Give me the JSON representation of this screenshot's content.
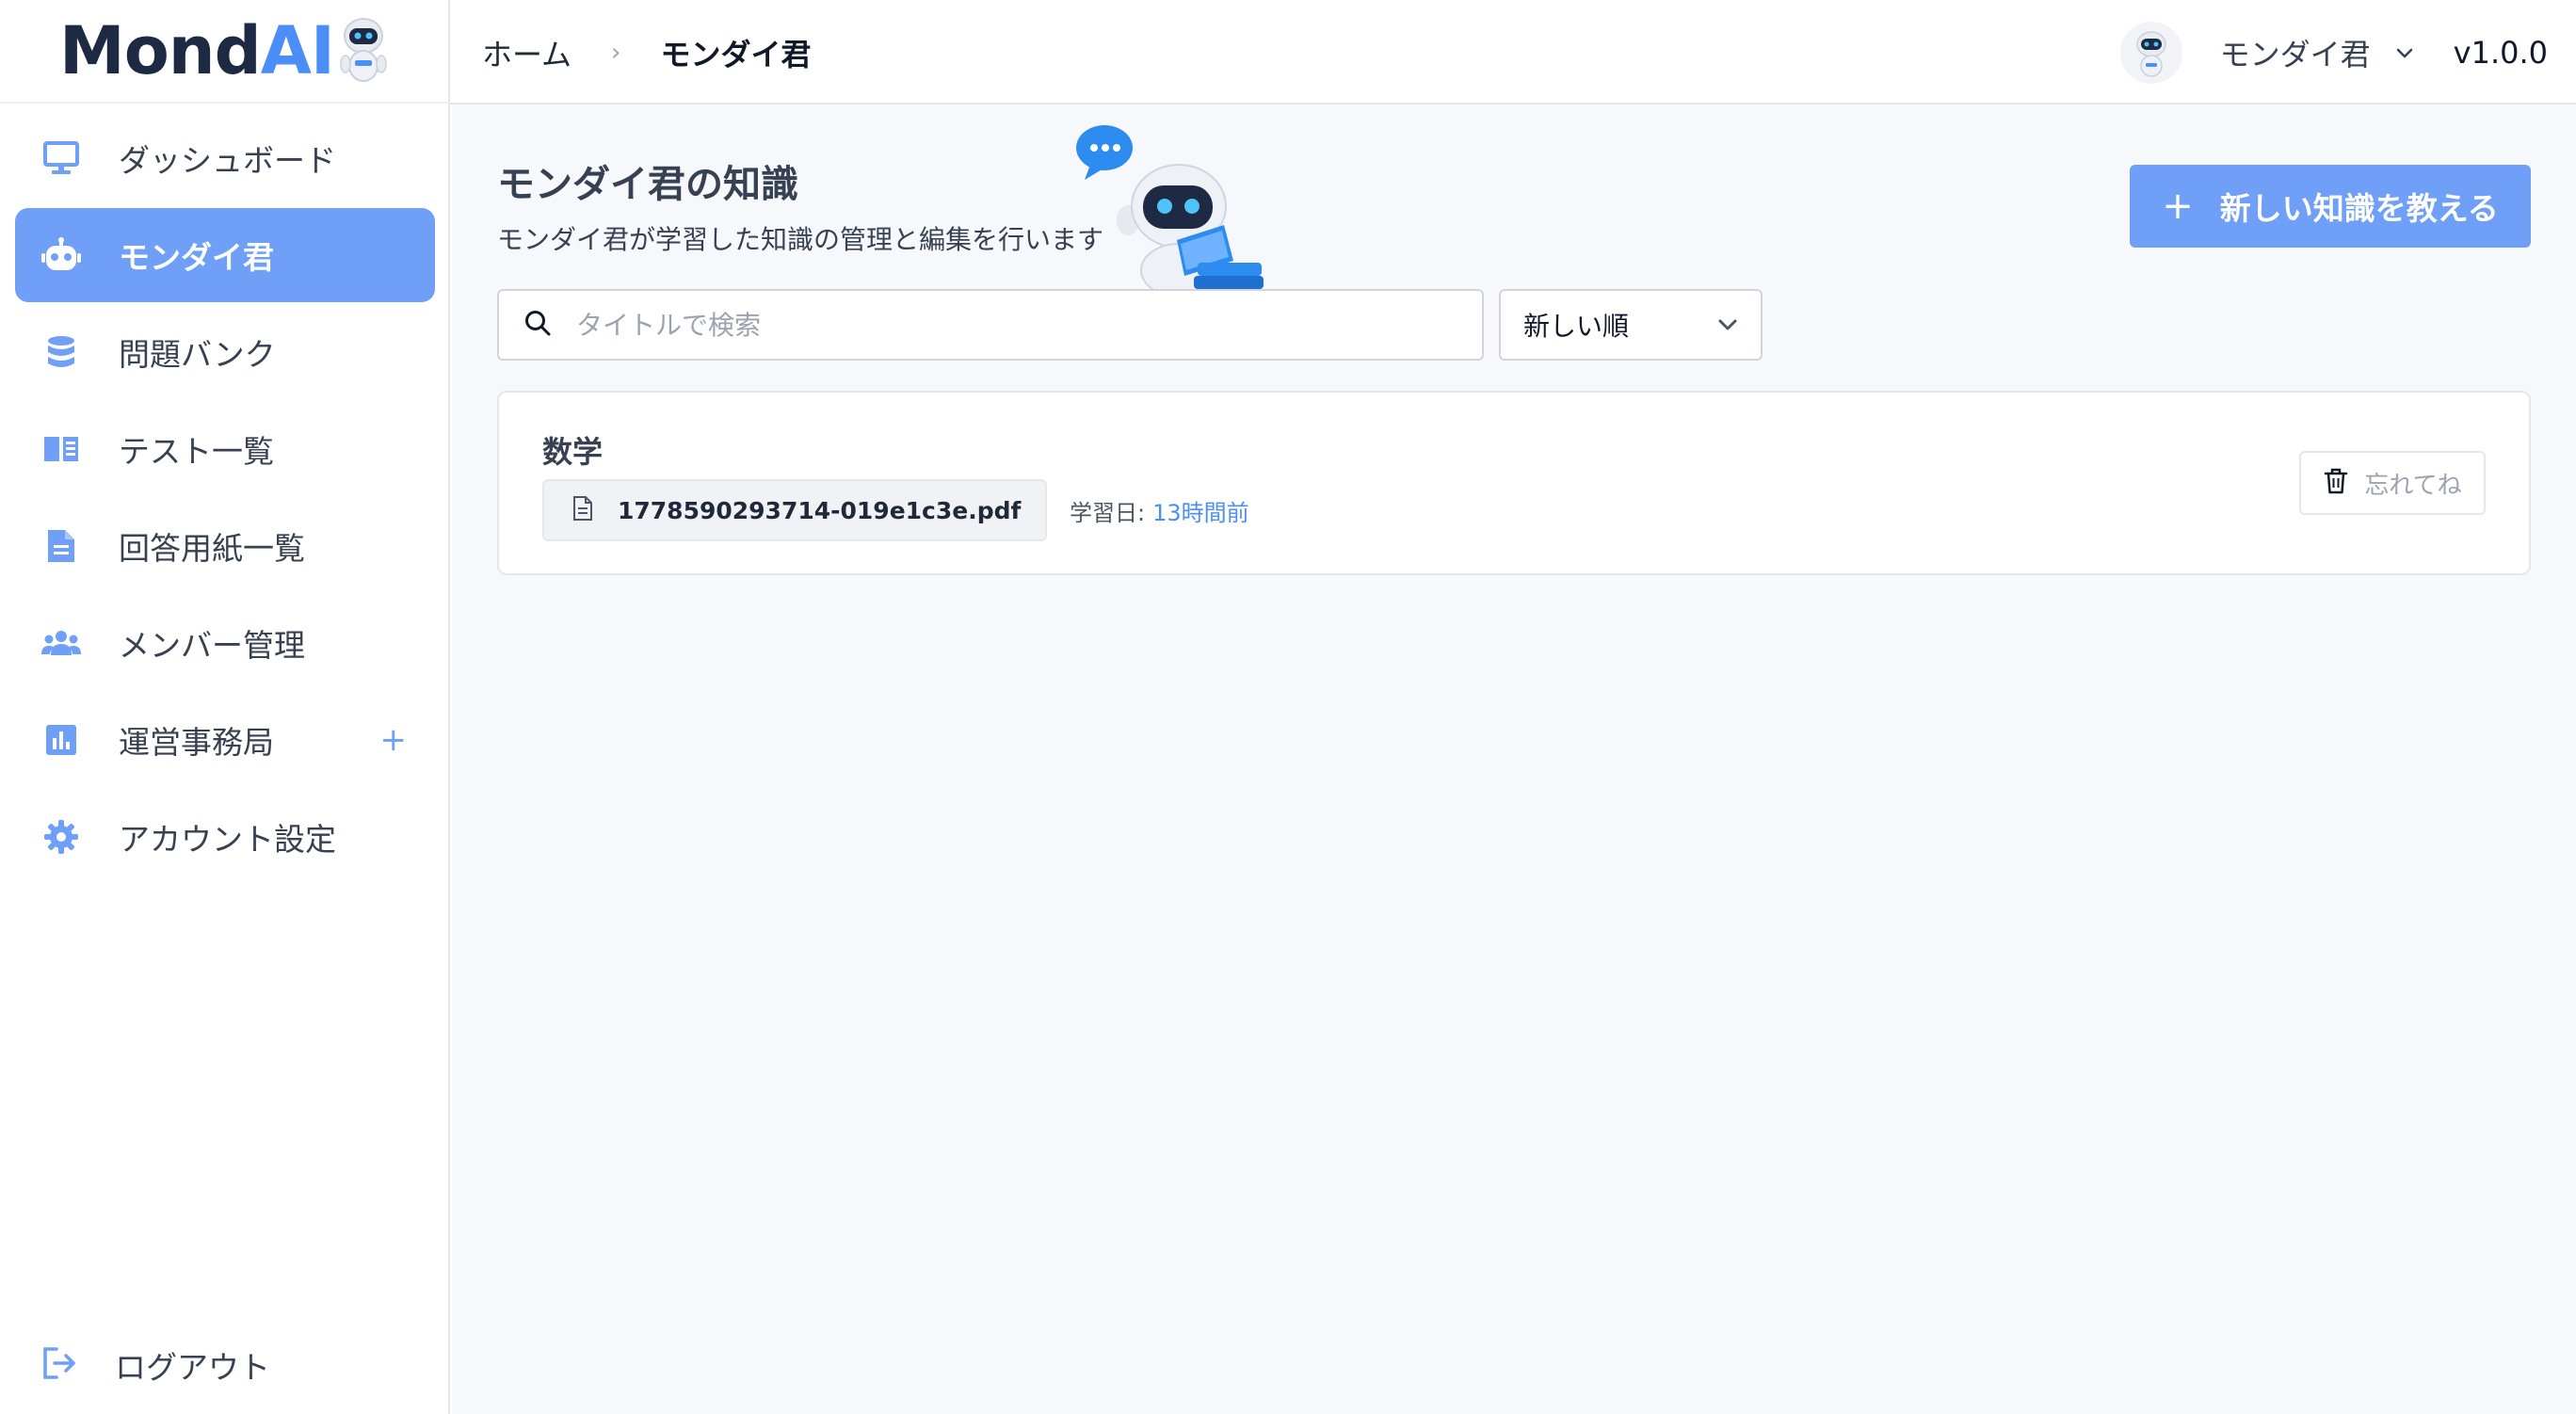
{
  "brand": {
    "logo_main": "Mond",
    "logo_accent": "AI"
  },
  "sidebar": {
    "items": [
      {
        "label": "ダッシュボード",
        "icon": "monitor-icon"
      },
      {
        "label": "モンダイ君",
        "icon": "robot-icon",
        "active": true
      },
      {
        "label": "問題バンク",
        "icon": "database-icon"
      },
      {
        "label": "テスト一覧",
        "icon": "book-open-icon"
      },
      {
        "label": "回答用紙一覧",
        "icon": "document-icon"
      },
      {
        "label": "メンバー管理",
        "icon": "users-icon"
      },
      {
        "label": "運営事務局",
        "icon": "chart-icon",
        "expand": "+"
      },
      {
        "label": "アカウント設定",
        "icon": "gear-icon"
      }
    ],
    "logout_label": "ログアウト"
  },
  "header": {
    "breadcrumb_home": "ホーム",
    "breadcrumb_separator": "›",
    "breadcrumb_current": "モンダイ君",
    "user_name": "モンダイ君",
    "version": "v1.0.0"
  },
  "main": {
    "title": "モンダイ君の知識",
    "description": "モンダイ君が学習した知識の管理と編集を行います",
    "add_button_plus": "+",
    "add_button_label": "新しい知識を教える",
    "search_placeholder": "タイトルで検索",
    "sort_selected": "新しい順",
    "knowledge_items": [
      {
        "title": "数学",
        "file_name": "1778590293714-019e1c3e.pdf",
        "learned_label": "学習日:",
        "learned_value": "13時間前",
        "forget_label": "忘れてね"
      }
    ]
  },
  "colors": {
    "accent": "#6f9ff7",
    "accent_text": "#4c8ef7",
    "brand_dark": "#1e2a44"
  }
}
